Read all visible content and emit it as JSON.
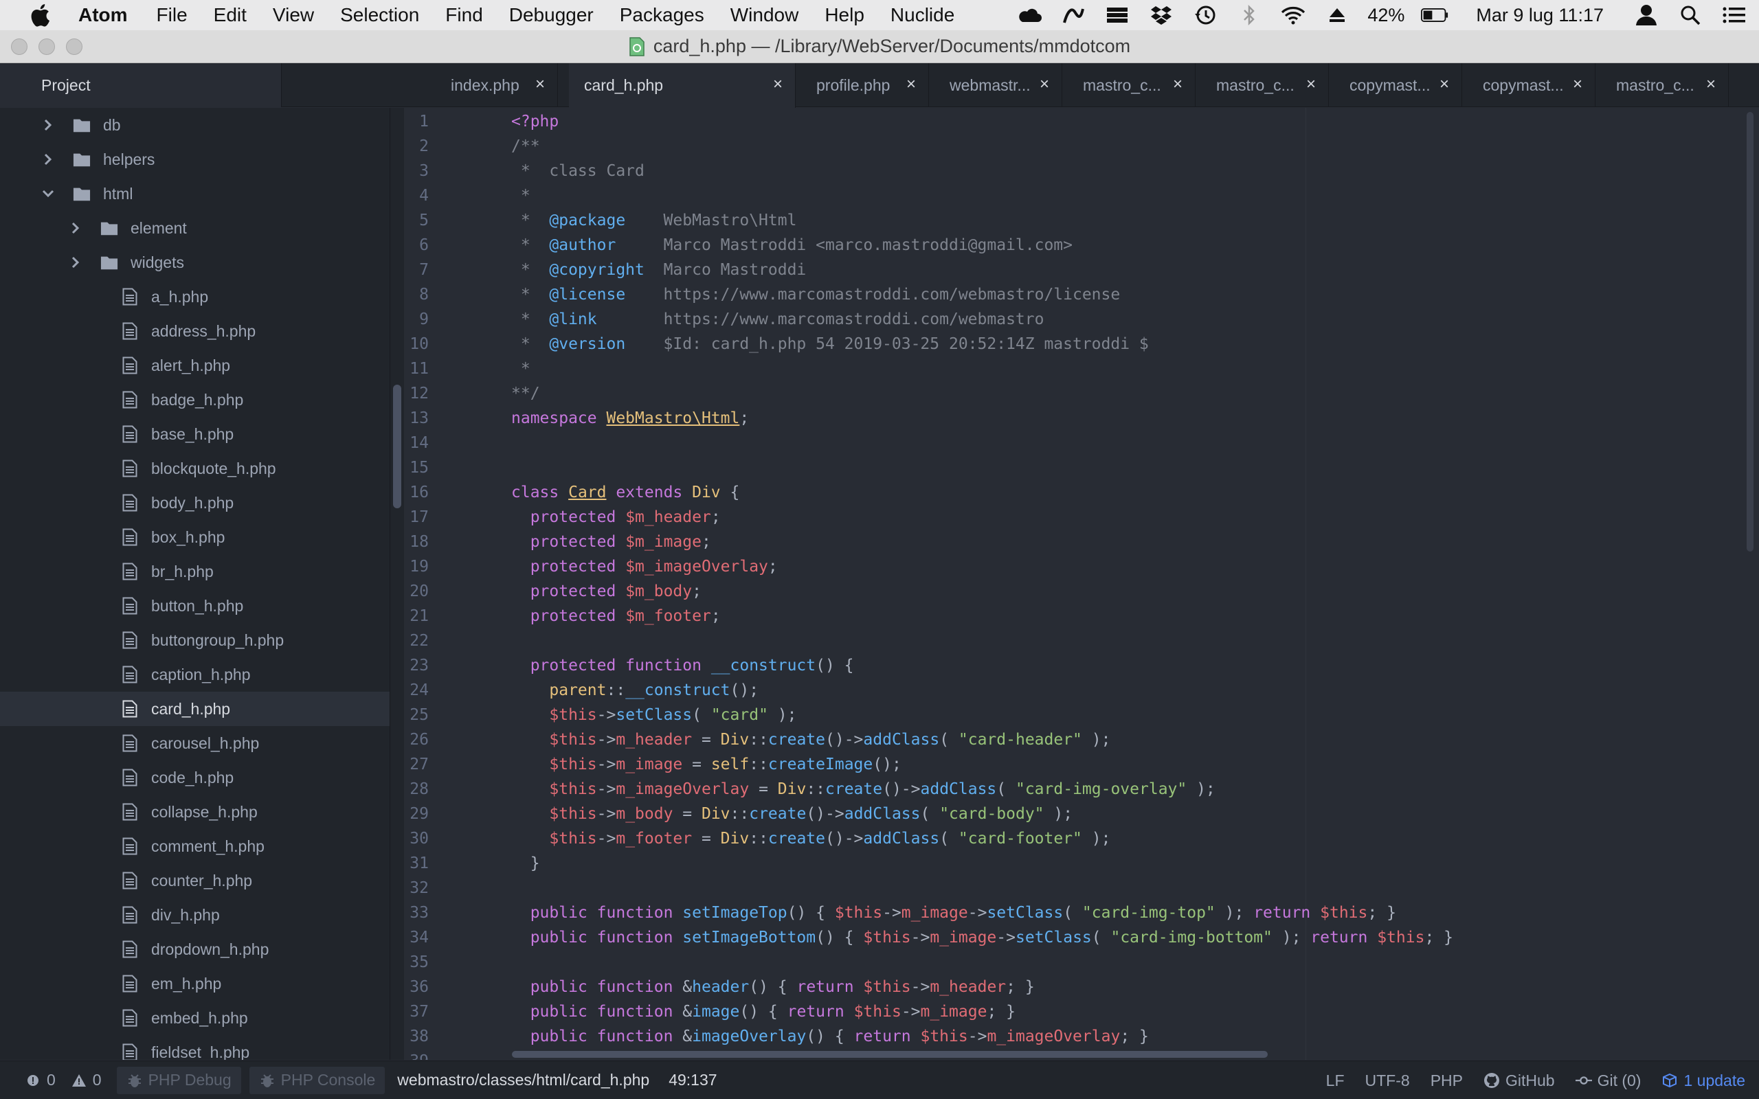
{
  "menubar": {
    "app_name": "Atom",
    "items": [
      "File",
      "Edit",
      "View",
      "Selection",
      "Find",
      "Debugger",
      "Packages",
      "Window",
      "Help",
      "Nuclide"
    ],
    "battery": "42%",
    "datetime": "Mar 9 lug  11:17",
    "status_icons": [
      "cloud-icon",
      "pen-icon",
      "stack-icon",
      "dropbox-icon",
      "time-machine-icon",
      "bluetooth-icon",
      "wifi-icon",
      "eject-icon",
      "battery-icon",
      "user-icon",
      "spotlight-search-icon",
      "notification-list-icon"
    ]
  },
  "window": {
    "title": "card_h.php — /Library/WebServer/Documents/mmdotcom"
  },
  "tabs": {
    "project_label": "Project",
    "items": [
      {
        "label": "index.php"
      },
      {
        "label": "card_h.php"
      },
      {
        "label": "profile.php"
      },
      {
        "label": "webmastr..."
      },
      {
        "label": "mastro_c..."
      },
      {
        "label": "mastro_c..."
      },
      {
        "label": "copymast..."
      },
      {
        "label": "copymast..."
      },
      {
        "label": "mastro_c..."
      }
    ]
  },
  "tree": {
    "items": [
      {
        "label": "db",
        "type": "folder"
      },
      {
        "label": "helpers",
        "type": "folder"
      },
      {
        "label": "html",
        "type": "folder-open"
      },
      {
        "label": "element",
        "type": "folder"
      },
      {
        "label": "widgets",
        "type": "folder"
      },
      {
        "label": "a_h.php",
        "type": "file"
      },
      {
        "label": "address_h.php",
        "type": "file"
      },
      {
        "label": "alert_h.php",
        "type": "file"
      },
      {
        "label": "badge_h.php",
        "type": "file"
      },
      {
        "label": "base_h.php",
        "type": "file"
      },
      {
        "label": "blockquote_h.php",
        "type": "file"
      },
      {
        "label": "body_h.php",
        "type": "file"
      },
      {
        "label": "box_h.php",
        "type": "file"
      },
      {
        "label": "br_h.php",
        "type": "file"
      },
      {
        "label": "button_h.php",
        "type": "file"
      },
      {
        "label": "buttongroup_h.php",
        "type": "file"
      },
      {
        "label": "caption_h.php",
        "type": "file"
      },
      {
        "label": "card_h.php",
        "type": "file",
        "selected": true
      },
      {
        "label": "carousel_h.php",
        "type": "file"
      },
      {
        "label": "code_h.php",
        "type": "file"
      },
      {
        "label": "collapse_h.php",
        "type": "file"
      },
      {
        "label": "comment_h.php",
        "type": "file"
      },
      {
        "label": "counter_h.php",
        "type": "file"
      },
      {
        "label": "div_h.php",
        "type": "file"
      },
      {
        "label": "dropdown_h.php",
        "type": "file"
      },
      {
        "label": "em_h.php",
        "type": "file"
      },
      {
        "label": "embed_h.php",
        "type": "file"
      },
      {
        "label": "fieldset_h.php",
        "type": "file"
      }
    ]
  },
  "editor": {
    "lines": [
      [
        [
          "c-tag",
          "<?php"
        ]
      ],
      [
        [
          "c-com",
          "/**"
        ]
      ],
      [
        [
          "c-com",
          " *  class Card"
        ]
      ],
      [
        [
          "c-com",
          " *"
        ]
      ],
      [
        [
          "c-com",
          " *  "
        ],
        [
          "c-fn",
          "@package"
        ],
        [
          "c-com",
          "    WebMastro\\Html"
        ]
      ],
      [
        [
          "c-com",
          " *  "
        ],
        [
          "c-fn",
          "@author"
        ],
        [
          "c-com",
          "     Marco Mastroddi <marco.mastroddi@gmail.com>"
        ]
      ],
      [
        [
          "c-com",
          " *  "
        ],
        [
          "c-fn",
          "@copyright"
        ],
        [
          "c-com",
          "  Marco Mastroddi"
        ]
      ],
      [
        [
          "c-com",
          " *  "
        ],
        [
          "c-fn",
          "@license"
        ],
        [
          "c-com",
          "    https://www.marcomastroddi.com/webmastro/license"
        ]
      ],
      [
        [
          "c-com",
          " *  "
        ],
        [
          "c-fn",
          "@link"
        ],
        [
          "c-com",
          "       https://www.marcomastroddi.com/webmastro"
        ]
      ],
      [
        [
          "c-com",
          " *  "
        ],
        [
          "c-fn",
          "@version"
        ],
        [
          "c-com",
          "    $Id: card_h.php 54 2019-03-25 20:52:14Z mastroddi $"
        ]
      ],
      [
        [
          "c-com",
          " *"
        ]
      ],
      [
        [
          "c-com",
          "**/"
        ]
      ],
      [
        [
          "c-kw",
          "namespace "
        ],
        [
          "c-ul",
          "WebMastro\\Html"
        ],
        [
          "c-plain",
          ";"
        ]
      ],
      [],
      [],
      [
        [
          "c-kw",
          "class "
        ],
        [
          "c-ul",
          "Card"
        ],
        [
          "c-kw",
          " extends "
        ],
        [
          "c-cls",
          "Div"
        ],
        [
          "c-plain",
          " {"
        ]
      ],
      [
        [
          "c-plain",
          "  "
        ],
        [
          "c-kw",
          "protected "
        ],
        [
          "c-var",
          "$m_header"
        ],
        [
          "c-plain",
          ";"
        ]
      ],
      [
        [
          "c-plain",
          "  "
        ],
        [
          "c-kw",
          "protected "
        ],
        [
          "c-var",
          "$m_image"
        ],
        [
          "c-plain",
          ";"
        ]
      ],
      [
        [
          "c-plain",
          "  "
        ],
        [
          "c-kw",
          "protected "
        ],
        [
          "c-var",
          "$m_imageOverlay"
        ],
        [
          "c-plain",
          ";"
        ]
      ],
      [
        [
          "c-plain",
          "  "
        ],
        [
          "c-kw",
          "protected "
        ],
        [
          "c-var",
          "$m_body"
        ],
        [
          "c-plain",
          ";"
        ]
      ],
      [
        [
          "c-plain",
          "  "
        ],
        [
          "c-kw",
          "protected "
        ],
        [
          "c-var",
          "$m_footer"
        ],
        [
          "c-plain",
          ";"
        ]
      ],
      [],
      [
        [
          "c-plain",
          "  "
        ],
        [
          "c-kw",
          "protected function "
        ],
        [
          "c-fn",
          "__construct"
        ],
        [
          "c-plain",
          "() {"
        ]
      ],
      [
        [
          "c-plain",
          "    "
        ],
        [
          "c-cls",
          "parent"
        ],
        [
          "c-plain",
          "::"
        ],
        [
          "c-fn",
          "__construct"
        ],
        [
          "c-plain",
          "();"
        ]
      ],
      [
        [
          "c-plain",
          "    "
        ],
        [
          "c-var",
          "$this"
        ],
        [
          "c-plain",
          "->"
        ],
        [
          "c-fn",
          "setClass"
        ],
        [
          "c-plain",
          "( "
        ],
        [
          "c-str",
          "\"card\""
        ],
        [
          "c-plain",
          " );"
        ]
      ],
      [
        [
          "c-plain",
          "    "
        ],
        [
          "c-var",
          "$this"
        ],
        [
          "c-plain",
          "->"
        ],
        [
          "c-var",
          "m_header"
        ],
        [
          "c-plain",
          " = "
        ],
        [
          "c-cls",
          "Div"
        ],
        [
          "c-plain",
          "::"
        ],
        [
          "c-fn",
          "create"
        ],
        [
          "c-plain",
          "()->"
        ],
        [
          "c-fn",
          "addClass"
        ],
        [
          "c-plain",
          "( "
        ],
        [
          "c-str",
          "\"card-header\""
        ],
        [
          "c-plain",
          " );"
        ]
      ],
      [
        [
          "c-plain",
          "    "
        ],
        [
          "c-var",
          "$this"
        ],
        [
          "c-plain",
          "->"
        ],
        [
          "c-var",
          "m_image"
        ],
        [
          "c-plain",
          " = "
        ],
        [
          "c-cls",
          "self"
        ],
        [
          "c-plain",
          "::"
        ],
        [
          "c-fn",
          "createImage"
        ],
        [
          "c-plain",
          "();"
        ]
      ],
      [
        [
          "c-plain",
          "    "
        ],
        [
          "c-var",
          "$this"
        ],
        [
          "c-plain",
          "->"
        ],
        [
          "c-var",
          "m_imageOverlay"
        ],
        [
          "c-plain",
          " = "
        ],
        [
          "c-cls",
          "Div"
        ],
        [
          "c-plain",
          "::"
        ],
        [
          "c-fn",
          "create"
        ],
        [
          "c-plain",
          "()->"
        ],
        [
          "c-fn",
          "addClass"
        ],
        [
          "c-plain",
          "( "
        ],
        [
          "c-str",
          "\"card-img-overlay\""
        ],
        [
          "c-plain",
          " );"
        ]
      ],
      [
        [
          "c-plain",
          "    "
        ],
        [
          "c-var",
          "$this"
        ],
        [
          "c-plain",
          "->"
        ],
        [
          "c-var",
          "m_body"
        ],
        [
          "c-plain",
          " = "
        ],
        [
          "c-cls",
          "Div"
        ],
        [
          "c-plain",
          "::"
        ],
        [
          "c-fn",
          "create"
        ],
        [
          "c-plain",
          "()->"
        ],
        [
          "c-fn",
          "addClass"
        ],
        [
          "c-plain",
          "( "
        ],
        [
          "c-str",
          "\"card-body\""
        ],
        [
          "c-plain",
          " );"
        ]
      ],
      [
        [
          "c-plain",
          "    "
        ],
        [
          "c-var",
          "$this"
        ],
        [
          "c-plain",
          "->"
        ],
        [
          "c-var",
          "m_footer"
        ],
        [
          "c-plain",
          " = "
        ],
        [
          "c-cls",
          "Div"
        ],
        [
          "c-plain",
          "::"
        ],
        [
          "c-fn",
          "create"
        ],
        [
          "c-plain",
          "()->"
        ],
        [
          "c-fn",
          "addClass"
        ],
        [
          "c-plain",
          "( "
        ],
        [
          "c-str",
          "\"card-footer\""
        ],
        [
          "c-plain",
          " );"
        ]
      ],
      [
        [
          "c-plain",
          "  }"
        ]
      ],
      [],
      [
        [
          "c-plain",
          "  "
        ],
        [
          "c-kw",
          "public function "
        ],
        [
          "c-fn",
          "setImageTop"
        ],
        [
          "c-plain",
          "() { "
        ],
        [
          "c-var",
          "$this"
        ],
        [
          "c-plain",
          "->"
        ],
        [
          "c-var",
          "m_image"
        ],
        [
          "c-plain",
          "->"
        ],
        [
          "c-fn",
          "setClass"
        ],
        [
          "c-plain",
          "( "
        ],
        [
          "c-str",
          "\"card-img-top\""
        ],
        [
          "c-plain",
          " ); "
        ],
        [
          "c-kw",
          "return "
        ],
        [
          "c-var",
          "$this"
        ],
        [
          "c-plain",
          "; }"
        ]
      ],
      [
        [
          "c-plain",
          "  "
        ],
        [
          "c-kw",
          "public function "
        ],
        [
          "c-fn",
          "setImageBottom"
        ],
        [
          "c-plain",
          "() { "
        ],
        [
          "c-var",
          "$this"
        ],
        [
          "c-plain",
          "->"
        ],
        [
          "c-var",
          "m_image"
        ],
        [
          "c-plain",
          "->"
        ],
        [
          "c-fn",
          "setClass"
        ],
        [
          "c-plain",
          "( "
        ],
        [
          "c-str",
          "\"card-img-bottom\""
        ],
        [
          "c-plain",
          " ); "
        ],
        [
          "c-kw",
          "return "
        ],
        [
          "c-var",
          "$this"
        ],
        [
          "c-plain",
          "; }"
        ]
      ],
      [],
      [
        [
          "c-plain",
          "  "
        ],
        [
          "c-kw",
          "public function "
        ],
        [
          "c-plain",
          "&"
        ],
        [
          "c-fn",
          "header"
        ],
        [
          "c-plain",
          "() { "
        ],
        [
          "c-kw",
          "return "
        ],
        [
          "c-var",
          "$this"
        ],
        [
          "c-plain",
          "->"
        ],
        [
          "c-var",
          "m_header"
        ],
        [
          "c-plain",
          "; }"
        ]
      ],
      [
        [
          "c-plain",
          "  "
        ],
        [
          "c-kw",
          "public function "
        ],
        [
          "c-plain",
          "&"
        ],
        [
          "c-fn",
          "image"
        ],
        [
          "c-plain",
          "() { "
        ],
        [
          "c-kw",
          "return "
        ],
        [
          "c-var",
          "$this"
        ],
        [
          "c-plain",
          "->"
        ],
        [
          "c-var",
          "m_image"
        ],
        [
          "c-plain",
          "; }"
        ]
      ],
      [
        [
          "c-plain",
          "  "
        ],
        [
          "c-kw",
          "public function "
        ],
        [
          "c-plain",
          "&"
        ],
        [
          "c-fn",
          "imageOverlay"
        ],
        [
          "c-plain",
          "() { "
        ],
        [
          "c-kw",
          "return "
        ],
        [
          "c-var",
          "$this"
        ],
        [
          "c-plain",
          "->"
        ],
        [
          "c-var",
          "m_imageOverlay"
        ],
        [
          "c-plain",
          "; }"
        ]
      ]
    ]
  },
  "statusbar": {
    "errors": "0",
    "warnings": "0",
    "php_debug": "PHP Debug",
    "php_console": "PHP Console",
    "file_path": "webmastro/classes/html/card_h.php",
    "cursor": "49:137",
    "line_ending": "LF",
    "encoding": "UTF-8",
    "grammar": "PHP",
    "github": "GitHub",
    "git": "Git (0)",
    "update": "1 update"
  }
}
